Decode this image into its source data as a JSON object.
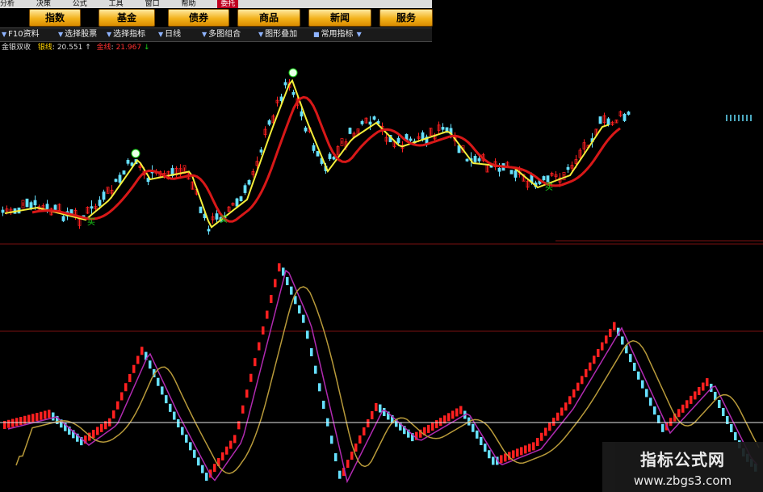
{
  "menu": {
    "items": [
      "分析",
      "决策",
      "公式",
      "工具",
      "窗口",
      "帮助"
    ],
    "special": "委托"
  },
  "nav": {
    "buttons": [
      "指数",
      "基金",
      "债券",
      "商品",
      "新闻",
      "服务"
    ]
  },
  "toolbar": {
    "items": [
      "F10资料",
      "选择股票",
      "选择指标",
      "日线",
      "多图组合",
      "图形叠加",
      "常用指标"
    ]
  },
  "status": {
    "indicator_name": "金银双收",
    "silver_label": "银线",
    "silver_value": "20.551",
    "silver_arrow": "↑",
    "gold_label": "金线",
    "gold_value": "21.967",
    "gold_arrow": "↓"
  },
  "signals": {
    "buy": "买",
    "sell": "卖"
  },
  "watermark": {
    "title": "指标公式网",
    "url": "www.zbgs3.com"
  },
  "colors": {
    "up": "#ff2020",
    "down": "#66e0ff",
    "silver_line": "#f5ee3a",
    "gold_line": "#d81818",
    "osc_line1": "#b02ab0",
    "osc_line2": "#b89a3a",
    "menu_button": "#f2b21a"
  }
}
